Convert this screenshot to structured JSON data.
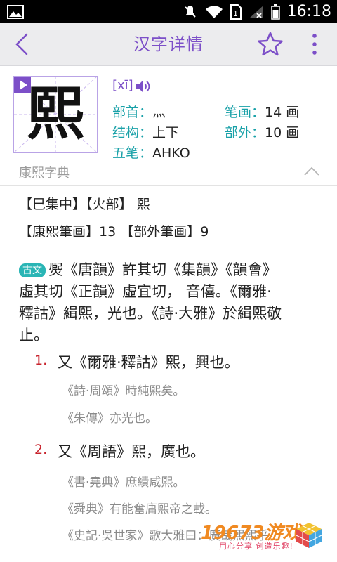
{
  "status_bar": {
    "time": "16:18"
  },
  "app_bar": {
    "title": "汉字详情"
  },
  "character": {
    "glyph": "熙",
    "pinyin": "[xī]",
    "bushou_label": "部首：",
    "bushou_value": "灬",
    "bihua_label": "笔画：",
    "bihua_value": "14 画",
    "jiegou_label": "结构：",
    "jiegou_value": "上下",
    "buwai_label": "部外：",
    "buwai_value": "10 画",
    "wubi_label": "五笔：",
    "wubi_value": "AHKO"
  },
  "section": {
    "name": "康熙字典"
  },
  "kangxi": {
    "line1": "【巳集中】【火部】 熙",
    "line2": "【康熙筆画】13 【部外筆画】9",
    "badge": "古文",
    "para_1": "㷩《唐韻》許其切《集韻》《韻會》",
    "para_2": "虛其切《正韻》虛宜切， 音僖。《爾雅·",
    "para_3": "釋詁》緝熙，光也。《詩·大雅》於緝熙敬",
    "para_4": "止。",
    "defs": [
      {
        "num": "1.",
        "text": "又《爾雅·釋詁》熙，興也。",
        "examples": [
          "《詩·周頌》時純熙矣。",
          "《朱傳》亦光也。"
        ]
      },
      {
        "num": "2.",
        "text": "又《周語》熙，廣也。",
        "examples": [
          "《書·堯典》庶績咸熙。",
          "《舜典》有能奮庸熙帝之載。",
          "《史記·吳世家》歌大雅曰：廣哉熙熙乎"
        ]
      }
    ]
  },
  "watermark": {
    "brand": "19673游戏",
    "slogan": "用心分享 创造乐趣!"
  },
  "colors": {
    "accent": "#7c4fc8",
    "label": "#19a1a8",
    "number": "#c8232c",
    "badge": "#2ab5b5"
  },
  "icons": [
    "image-icon",
    "mute-icon",
    "wifi-icon",
    "sim-icon",
    "signal-icon",
    "battery-icon",
    "back-arrow-icon",
    "star-icon",
    "more-vert-icon",
    "play-icon",
    "speaker-icon",
    "chevron-up-icon"
  ]
}
